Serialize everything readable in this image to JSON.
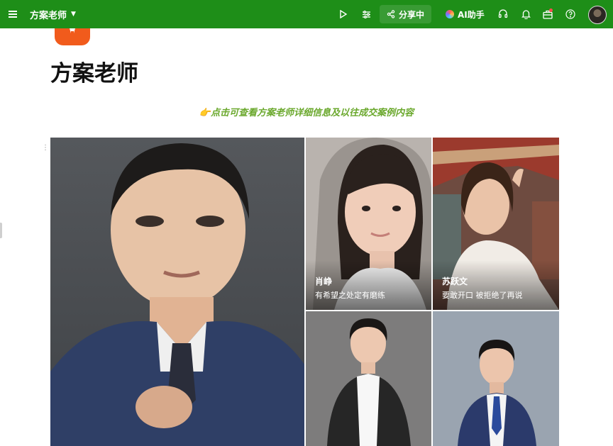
{
  "topbar": {
    "title": "方案老师",
    "share_label": "分享中",
    "ai_label": "AI助手"
  },
  "page": {
    "title": "方案老师",
    "hint": "👉点击可查看方案老师详细信息及以往成交案例内容"
  },
  "gallery": {
    "cards": [
      {
        "name": "",
        "desc": ""
      },
      {
        "name": "肖峥",
        "desc": "有希望之处定有磨练"
      },
      {
        "name": "苏跃文",
        "desc": "要敢开口 被拒绝了再说"
      },
      {
        "name": "",
        "desc": ""
      },
      {
        "name": "",
        "desc": ""
      }
    ]
  },
  "colors": {
    "topbar": "#1e8e18",
    "hint": "#6aa82c",
    "title_icon": "#f15b1c"
  }
}
